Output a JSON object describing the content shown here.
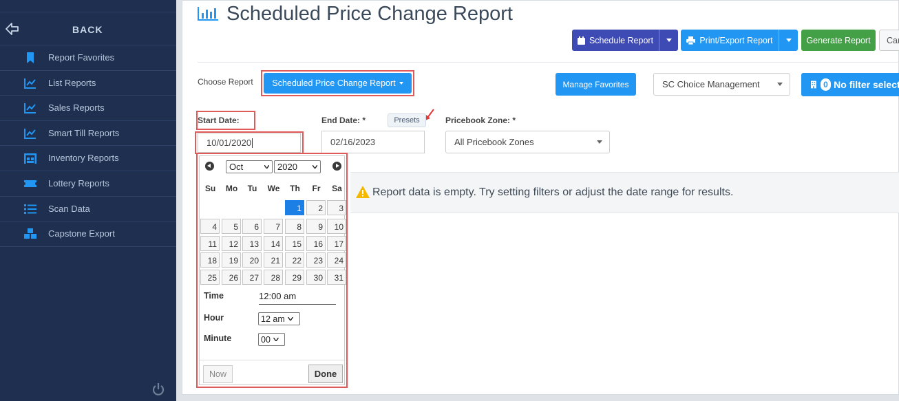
{
  "sidebar": {
    "back_label": "BACK",
    "items": [
      {
        "label": "Report Favorites",
        "icon": "bookmark-icon"
      },
      {
        "label": "List Reports",
        "icon": "line-chart-icon"
      },
      {
        "label": "Sales Reports",
        "icon": "line-chart-icon"
      },
      {
        "label": "Smart Till Reports",
        "icon": "line-chart-icon"
      },
      {
        "label": "Inventory Reports",
        "icon": "warehouse-icon"
      },
      {
        "label": "Lottery Reports",
        "icon": "ticket-icon"
      },
      {
        "label": "Scan Data",
        "icon": "list-icon"
      },
      {
        "label": "Capstone Export",
        "icon": "boxes-icon"
      }
    ]
  },
  "header": {
    "title": "Scheduled Price Change Report",
    "schedule_label": "Schedule Report",
    "print_label": "Print/Export Report",
    "generate_label": "Generate Report",
    "cancel_label": "Cancel"
  },
  "filters": {
    "choose_report_label": "Choose Report",
    "report_dropdown": "Scheduled Price Change Report",
    "manage_favorites": "Manage Favorites",
    "company_select": "SC Choice Management",
    "filter_count": "0",
    "filter_text": "No filter selected",
    "start_label": "Start Date:",
    "start_value": "10/01/2020",
    "end_label": "End Date: *",
    "end_value": "02/16/2023",
    "presets": "Presets",
    "zone_label": "Pricebook Zone: *",
    "zone_value": "All Pricebook Zones"
  },
  "empty_message": "Report data is empty. Try setting filters or adjust the date range for results.",
  "calendar": {
    "month": "Oct",
    "year": "2020",
    "dow": [
      "Su",
      "Mo",
      "Tu",
      "We",
      "Th",
      "Fr",
      "Sa"
    ],
    "weeks": [
      [
        "",
        "",
        "",
        "",
        "1",
        "2",
        "3"
      ],
      [
        "4",
        "5",
        "6",
        "7",
        "8",
        "9",
        "10"
      ],
      [
        "11",
        "12",
        "13",
        "14",
        "15",
        "16",
        "17"
      ],
      [
        "18",
        "19",
        "20",
        "21",
        "22",
        "23",
        "24"
      ],
      [
        "25",
        "26",
        "27",
        "28",
        "29",
        "30",
        "31"
      ]
    ],
    "selected_day": "1",
    "time_label": "Time",
    "time_value": "12:00 am",
    "hour_label": "Hour",
    "hour_value": "12 am",
    "minute_label": "Minute",
    "minute_value": "00",
    "now_label": "Now",
    "done_label": "Done"
  }
}
